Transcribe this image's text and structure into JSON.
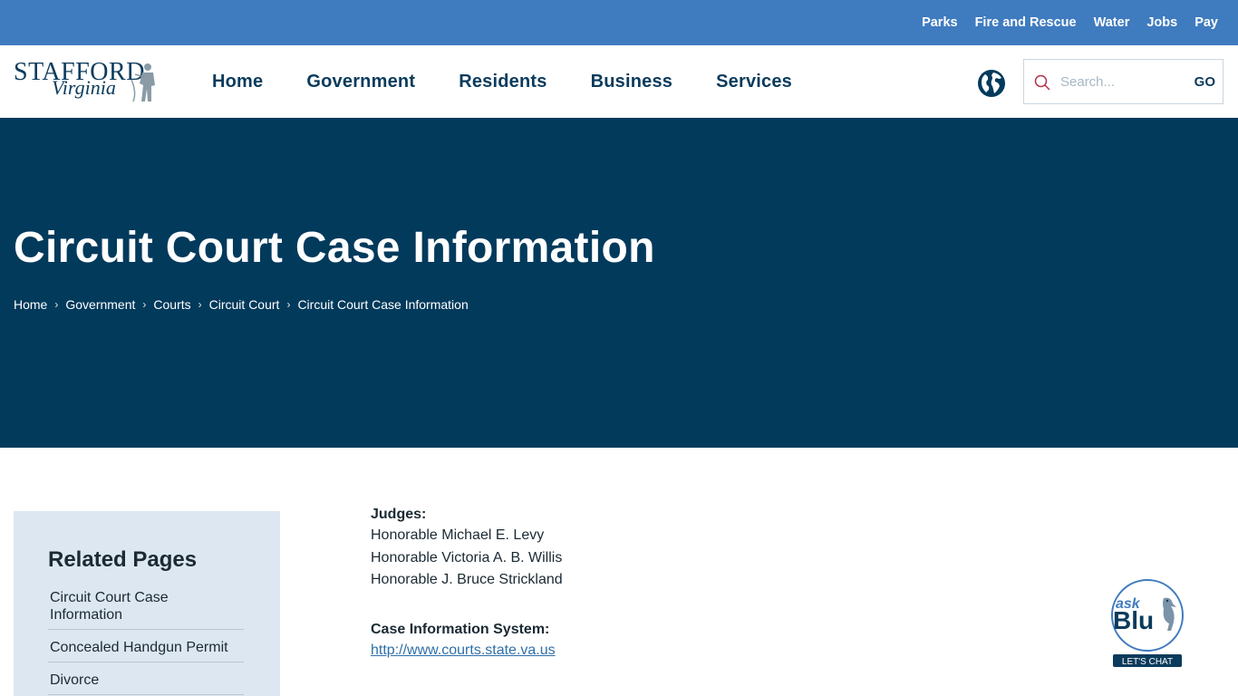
{
  "utility_nav": {
    "links": [
      "Parks",
      "Fire and Rescue",
      "Water",
      "Jobs",
      "Pay"
    ]
  },
  "header": {
    "logo_line1": "STAFFORD",
    "logo_line2": "Virginia",
    "nav": [
      "Home",
      "Government",
      "Residents",
      "Business",
      "Services"
    ],
    "search": {
      "placeholder": "Search...",
      "go_label": "GO"
    }
  },
  "hero": {
    "title": "Circuit Court Case Information",
    "breadcrumb": [
      "Home",
      "Government",
      "Courts",
      "Circuit Court",
      "Circuit Court Case Information"
    ],
    "separator": "›"
  },
  "sidebar": {
    "title": "Related Pages",
    "items": [
      "Circuit Court Case Information",
      "Concealed Handgun Permit",
      "Divorce"
    ]
  },
  "content": {
    "judges_label": "Judges:",
    "judges": [
      "Honorable Michael E. Levy",
      "Honorable Victoria A. B. Willis",
      "Honorable J. Bruce Strickland"
    ],
    "system_label": "Case Information System:",
    "system_link": "http://www.courts.state.va.us"
  },
  "chat_widget": {
    "ask": "ask",
    "brand": "Blu",
    "cta": "LET'S CHAT"
  },
  "colors": {
    "utility_bar": "#3f7bbf",
    "hero": "#023a5c",
    "nav_text": "#0b3b5c",
    "sidebar_bg": "#dce7f1",
    "link": "#2f6fa8"
  },
  "icons": {
    "globe": "globe-icon",
    "search": "search-icon"
  }
}
